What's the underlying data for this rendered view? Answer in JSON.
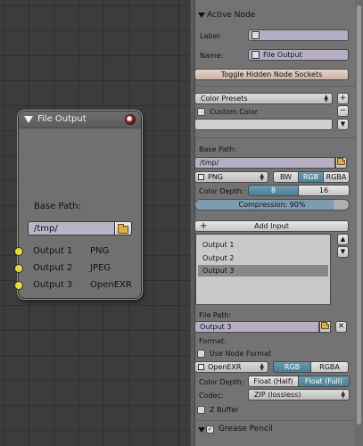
{
  "node": {
    "title": "File Output",
    "base_path_label": "Base Path:",
    "base_path_value": "/tmp/",
    "inputs": [
      {
        "name": "Output 1",
        "format": "PNG"
      },
      {
        "name": "Output 2",
        "format": "JPEG"
      },
      {
        "name": "Output 3",
        "format": "OpenEXR"
      }
    ]
  },
  "panel": {
    "active_node": {
      "title": "Active Node",
      "label_label": "Label:",
      "label_value": "",
      "name_label": "Name:",
      "name_value": "File Output",
      "toggle_sockets": "Toggle Hidden Node Sockets"
    },
    "color": {
      "presets": "Color Presets",
      "custom_color": "Custom Color"
    },
    "output": {
      "base_path_label": "Base Path:",
      "base_path_value": "/tmp/",
      "format": "PNG",
      "bw": "BW",
      "rgb": "RGB",
      "rgba": "RGBA",
      "color_depth_label": "Color Depth:",
      "depth_8": "8",
      "depth_16": "16",
      "compression": "Compression: 90%",
      "compression_fraction": 0.9,
      "add_input": "Add Input",
      "inputs": [
        "Output 1",
        "Output 2",
        "Output 3"
      ],
      "selected_input": 2
    },
    "file": {
      "path_label": "File Path:",
      "path_value": "Output 3",
      "format_label": "Format:",
      "use_node_format": "Use Node Format",
      "format": "OpenEXR",
      "rgb": "RGB",
      "rgba": "RGBA",
      "color_depth_label": "Color Depth:",
      "float_half": "Float (Half)",
      "float_full": "Float (Full)",
      "codec_label": "Codec:",
      "codec_value": "ZIP (lossless)",
      "zbuffer": "Z Buffer"
    },
    "grease_pencil": {
      "title": "Grease Pencil"
    }
  }
}
